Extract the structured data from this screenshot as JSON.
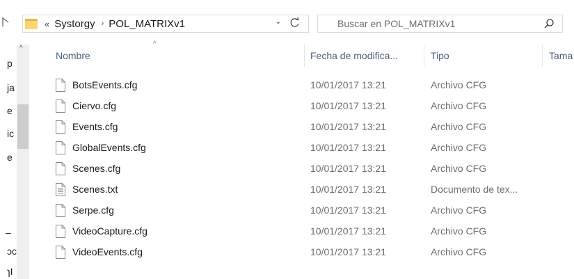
{
  "nav_up_icon": "up-arrow-icon",
  "address": {
    "overflow": "«",
    "crumbs": [
      "Systorgy",
      "POL_MATRIXv1"
    ],
    "separator": "›",
    "dropdown": "⌄",
    "refresh_icon": "refresh-icon"
  },
  "search": {
    "placeholder": "Buscar en POL_MATRIXv1",
    "icon": "search-icon"
  },
  "nav_pane": {
    "fragments": [
      "p",
      "ja",
      "e",
      "ic",
      "e",
      "–",
      "ɔc",
      "ɿI"
    ],
    "scroll_up": "^"
  },
  "columns": {
    "name": "Nombre",
    "date": "Fecha de modifica...",
    "type": "Tipo",
    "size": "Tama",
    "sort_indicator": "^"
  },
  "files": [
    {
      "name": "BotsEvents.cfg",
      "date": "10/01/2017 13:21",
      "type": "Archivo CFG",
      "icon": "file-icon"
    },
    {
      "name": "Ciervo.cfg",
      "date": "10/01/2017 13:21",
      "type": "Archivo CFG",
      "icon": "file-icon"
    },
    {
      "name": "Events.cfg",
      "date": "10/01/2017 13:21",
      "type": "Archivo CFG",
      "icon": "file-icon"
    },
    {
      "name": "GlobalEvents.cfg",
      "date": "10/01/2017 13:21",
      "type": "Archivo CFG",
      "icon": "file-icon"
    },
    {
      "name": "Scenes.cfg",
      "date": "10/01/2017 13:21",
      "type": "Archivo CFG",
      "icon": "file-icon"
    },
    {
      "name": "Scenes.txt",
      "date": "10/01/2017 13:21",
      "type": "Documento de tex...",
      "icon": "text-file-icon"
    },
    {
      "name": "Serpe.cfg",
      "date": "10/01/2017 13:21",
      "type": "Archivo CFG",
      "icon": "file-icon"
    },
    {
      "name": "VideoCapture.cfg",
      "date": "10/01/2017 13:21",
      "type": "Archivo CFG",
      "icon": "file-icon"
    },
    {
      "name": "VideoEvents.cfg",
      "date": "10/01/2017 13:21",
      "type": "Archivo CFG",
      "icon": "file-icon"
    }
  ],
  "colors": {
    "header_text": "#4c607a",
    "secondary_text": "#6d6d6d",
    "folder": "#f8d675"
  }
}
